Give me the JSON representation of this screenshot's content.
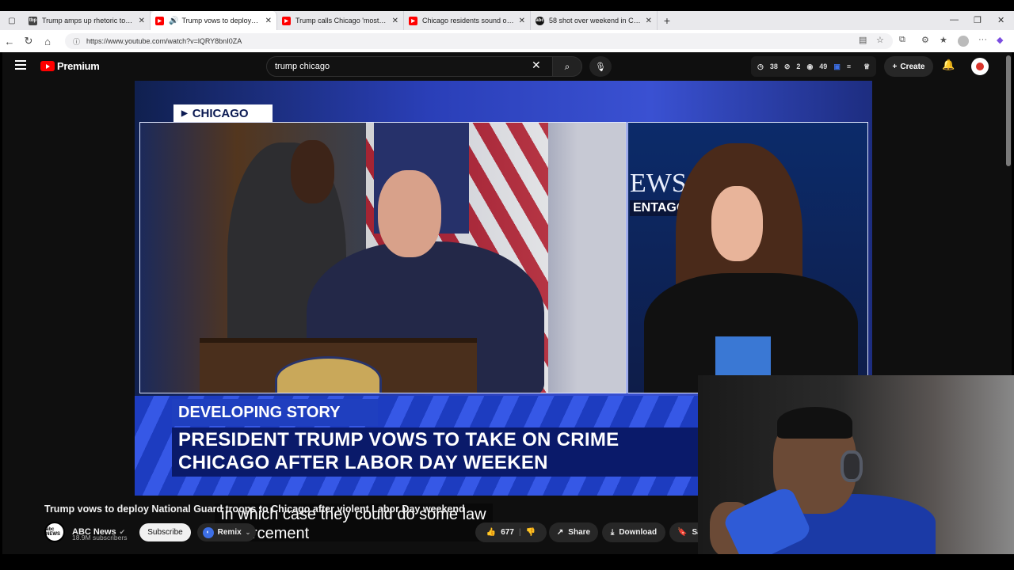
{
  "browser": {
    "tabs": [
      {
        "title": "Trump amps up rhetoric toward C",
        "favicon": "tbp",
        "fav_color": "#444444"
      },
      {
        "title": "Trump vows to deploy Natio",
        "favicon": "youtube",
        "fav_color": "#ff0000",
        "active": true
      },
      {
        "title": "Trump calls Chicago 'most dange",
        "favicon": "youtube",
        "fav_color": "#ff0000"
      },
      {
        "title": "Chicago residents sound off on T",
        "favicon": "youtube",
        "fav_color": "#ff0000"
      },
      {
        "title": "58 shot over weekend in Chicago",
        "favicon": "abc",
        "fav_color": "#111111"
      }
    ],
    "url": "https://www.youtube.com/watch?v=lQRY8bnI0ZA"
  },
  "youtube": {
    "brand": "Premium",
    "search_value": "trump chicago",
    "stats": {
      "a": "38",
      "b": "2",
      "c": "49"
    },
    "create_label": "Create"
  },
  "video": {
    "tag": "CHICAGO",
    "right_panel_text_1": "EWS",
    "right_panel_text_2": "ENTAGON",
    "lower_third_label": "DEVELOPING STORY",
    "headline_line1": "PRESIDENT TRUMP VOWS TO TAKE ON CRIME",
    "headline_line2": "CHICAGO AFTER LABOR DAY WEEKEN",
    "caption_line1": "in which case they could do some law",
    "caption_line2": "enforcement"
  },
  "meta": {
    "title": "Trump vows to deploy National Guard troops to Chicago after violent Labor Day weekend",
    "channel_name": "ABC News",
    "channel_avatar_text": "abc NEWS",
    "subscribers": "18.9M subscribers",
    "subscribe_label": "Subscribe",
    "remix_label": "Remix",
    "likes": "677",
    "share_label": "Share",
    "download_label": "Download",
    "save_label": "Sa"
  }
}
